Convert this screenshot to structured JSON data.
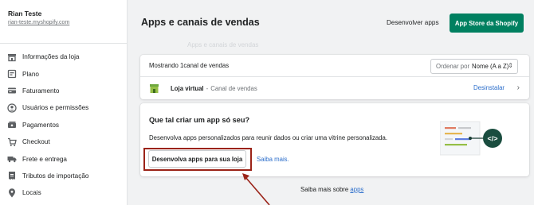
{
  "account": {
    "name": "Rian Teste",
    "store": "rian-teste.myshopify.com"
  },
  "nav": [
    {
      "label": "Informações da loja",
      "icon": "store-icon"
    },
    {
      "label": "Plano",
      "icon": "plan-icon"
    },
    {
      "label": "Faturamento",
      "icon": "billing-icon"
    },
    {
      "label": "Usuários e permissões",
      "icon": "user-icon"
    },
    {
      "label": "Pagamentos",
      "icon": "payments-icon"
    },
    {
      "label": "Checkout",
      "icon": "cart-icon"
    },
    {
      "label": "Frete e entrega",
      "icon": "truck-icon"
    },
    {
      "label": "Tributos de importação",
      "icon": "tax-icon"
    },
    {
      "label": "Locais",
      "icon": "location-icon"
    }
  ],
  "header": {
    "title": "Apps e canais de vendas",
    "develop_apps": "Desenvolver apps",
    "app_store": "App Store da Shopify",
    "ghost_text": "Apps e canais de vendas"
  },
  "apps_card": {
    "showing": "Mostrando 1canal de vendas",
    "sort_prefix": "Ordenar por",
    "sort_value": "Nome (A a Z)",
    "app_name": "Loja virtual",
    "app_separator": " - ",
    "app_sub": "Canal de vendas",
    "uninstall": "Desinstalar"
  },
  "create_card": {
    "title": "Que tal criar um app só seu?",
    "description": "Desenvolva apps personalizados para reunir dados ou criar uma vitrine personalizada.",
    "button": "Desenvolva apps para sua loja",
    "learn_more": "Saiba mais."
  },
  "footer": {
    "prefix": "Saiba mais sobre ",
    "link": "apps"
  },
  "colors": {
    "primary": "#008060",
    "link": "#2c6ecb",
    "highlight": "#9b2318"
  }
}
